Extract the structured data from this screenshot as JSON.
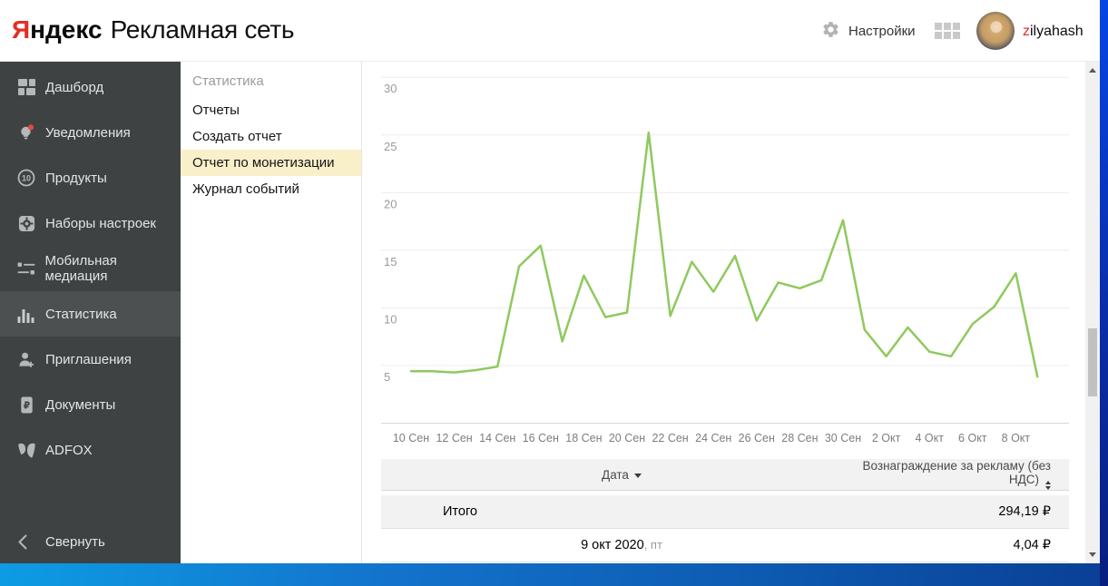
{
  "header": {
    "logo": {
      "brand_red": "Я",
      "brand_rest": "ндекс",
      "product": "Рекламная сеть"
    },
    "settings_label": "Настройки",
    "user": {
      "first": "z",
      "rest": "ilyahash"
    }
  },
  "sidebar": {
    "items": [
      {
        "id": "dashboard",
        "label": "Дашборд",
        "icon": "dashboard-icon"
      },
      {
        "id": "notifications",
        "label": "Уведомления",
        "icon": "notifications-icon",
        "has_badge": true
      },
      {
        "id": "products",
        "label": "Продукты",
        "icon": "products-icon",
        "icon_text": "10"
      },
      {
        "id": "settings-sets",
        "label": "Наборы настроек",
        "icon": "settings-sets-icon"
      },
      {
        "id": "mobile-mediation",
        "label": "Мобильная медиация",
        "icon": "mobile-mediation-icon"
      },
      {
        "id": "statistics",
        "label": "Статистика",
        "icon": "statistics-icon",
        "selected": true
      },
      {
        "id": "invitations",
        "label": "Приглашения",
        "icon": "invitations-icon"
      },
      {
        "id": "documents",
        "label": "Документы",
        "icon": "documents-icon"
      },
      {
        "id": "adfox",
        "label": "ADFOX",
        "icon": "adfox-icon"
      }
    ],
    "collapse_label": "Свернуть",
    "collapse_icon": "chevron-left-icon"
  },
  "submenu": {
    "title": "Статистика",
    "items": [
      {
        "id": "reports",
        "label": "Отчеты"
      },
      {
        "id": "create-report",
        "label": "Создать отчет"
      },
      {
        "id": "monetization-report",
        "label": "Отчет по монетизации",
        "selected": true
      },
      {
        "id": "event-log",
        "label": "Журнал событий"
      }
    ],
    "highlight_color": "#f9efc9"
  },
  "chart_data": {
    "type": "line",
    "title": "",
    "categories": [
      "10 Сен",
      "11 Сен",
      "12 Сен",
      "13 Сен",
      "14 Сен",
      "15 Сен",
      "16 Сен",
      "17 Сен",
      "18 Сен",
      "19 Сен",
      "20 Сен",
      "21 Сен",
      "22 Сен",
      "23 Сен",
      "24 Сен",
      "25 Сен",
      "26 Сен",
      "27 Сен",
      "28 Сен",
      "29 Сен",
      "30 Сен",
      "1 Окт",
      "2 Окт",
      "3 Окт",
      "4 Окт",
      "5 Окт",
      "6 Окт",
      "7 Окт",
      "8 Окт",
      "9 Окт"
    ],
    "values": [
      4.5,
      4.5,
      4.4,
      4.6,
      4.9,
      13.6,
      15.4,
      7.1,
      12.8,
      9.2,
      9.6,
      25.2,
      9.3,
      14.0,
      11.4,
      14.5,
      8.9,
      12.2,
      11.7,
      12.4,
      17.6,
      8.1,
      5.8,
      8.3,
      6.2,
      5.8,
      8.6,
      10.1,
      13.0,
      4.04
    ],
    "series_name": "Вознаграждение за рекламу (без НДС)",
    "x_tick_every": 2,
    "x_tick_labels": [
      "10 Сен",
      "12 Сен",
      "14 Сен",
      "16 Сен",
      "18 Сен",
      "20 Сен",
      "22 Сен",
      "24 Сен",
      "26 Сен",
      "28 Сен",
      "30 Сен",
      "2 Окт",
      "4 Окт",
      "6 Окт",
      "8 Окт"
    ],
    "y_ticks": [
      5,
      10,
      15,
      20,
      25,
      30
    ],
    "ylim": [
      0,
      31.4
    ],
    "grid": true,
    "legend": "none",
    "line_color": "#8fc95e"
  },
  "table": {
    "columns": [
      {
        "label": "Дата",
        "sort_icon": "dropdown-arrow-icon"
      },
      {
        "label": "Вознаграждение за рекламу (без НДС)",
        "sort_icon": "sort-updown-icon"
      }
    ],
    "rows": [
      {
        "date": "Итого",
        "date_note": "",
        "value": "294,19 ₽",
        "is_total": true
      },
      {
        "date": "9 окт 2020",
        "date_note": ", пт",
        "value": "4,04 ₽",
        "is_total": false
      }
    ]
  },
  "colors": {
    "brand_red": "#e22e24",
    "sidebar_bg": "#3e4242",
    "sidebar_selected_bg": "#4c5050",
    "submenu_highlight": "#f9efc9",
    "chart_line": "#8fc95e"
  }
}
